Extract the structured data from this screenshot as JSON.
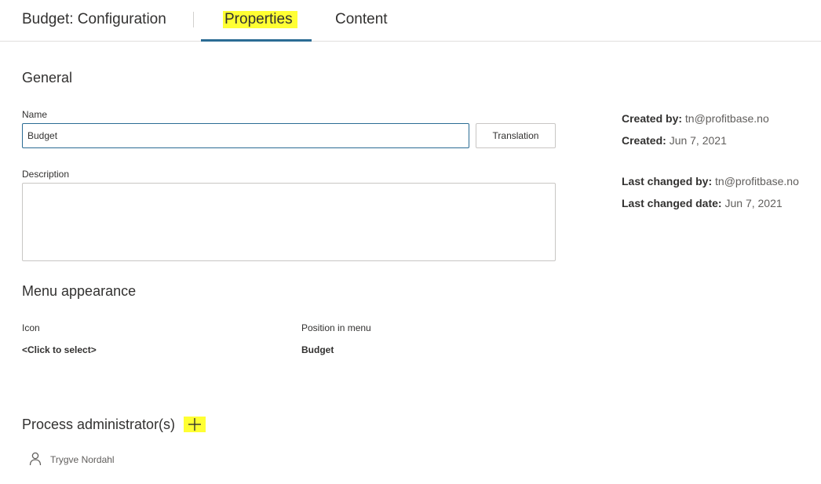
{
  "header": {
    "app_title": "Budget: Configuration",
    "tabs": [
      {
        "label": "Properties",
        "active": true
      },
      {
        "label": "Content",
        "active": false
      }
    ]
  },
  "general": {
    "title": "General",
    "name_label": "Name",
    "name_value": "Budget",
    "translation_button": "Translation",
    "description_label": "Description",
    "description_value": ""
  },
  "meta": {
    "created_by_label": "Created by:",
    "created_by_value": "tn@profitbase.no",
    "created_label": "Created:",
    "created_value": "Jun 7, 2021",
    "last_changed_by_label": "Last changed by:",
    "last_changed_by_value": "tn@profitbase.no",
    "last_changed_date_label": "Last changed date:",
    "last_changed_date_value": "Jun 7, 2021"
  },
  "menu_appearance": {
    "title": "Menu appearance",
    "icon_label": "Icon",
    "icon_value": "<Click to select>",
    "position_label": "Position in menu",
    "position_value": "Budget"
  },
  "process_admins": {
    "title": "Process administrator(s)",
    "add_icon": "plus-icon",
    "people": [
      {
        "name": "Trygve Nordahl",
        "icon": "person-icon"
      }
    ]
  },
  "colors": {
    "accent": "#2b6c94",
    "highlight": "#ffff33"
  }
}
